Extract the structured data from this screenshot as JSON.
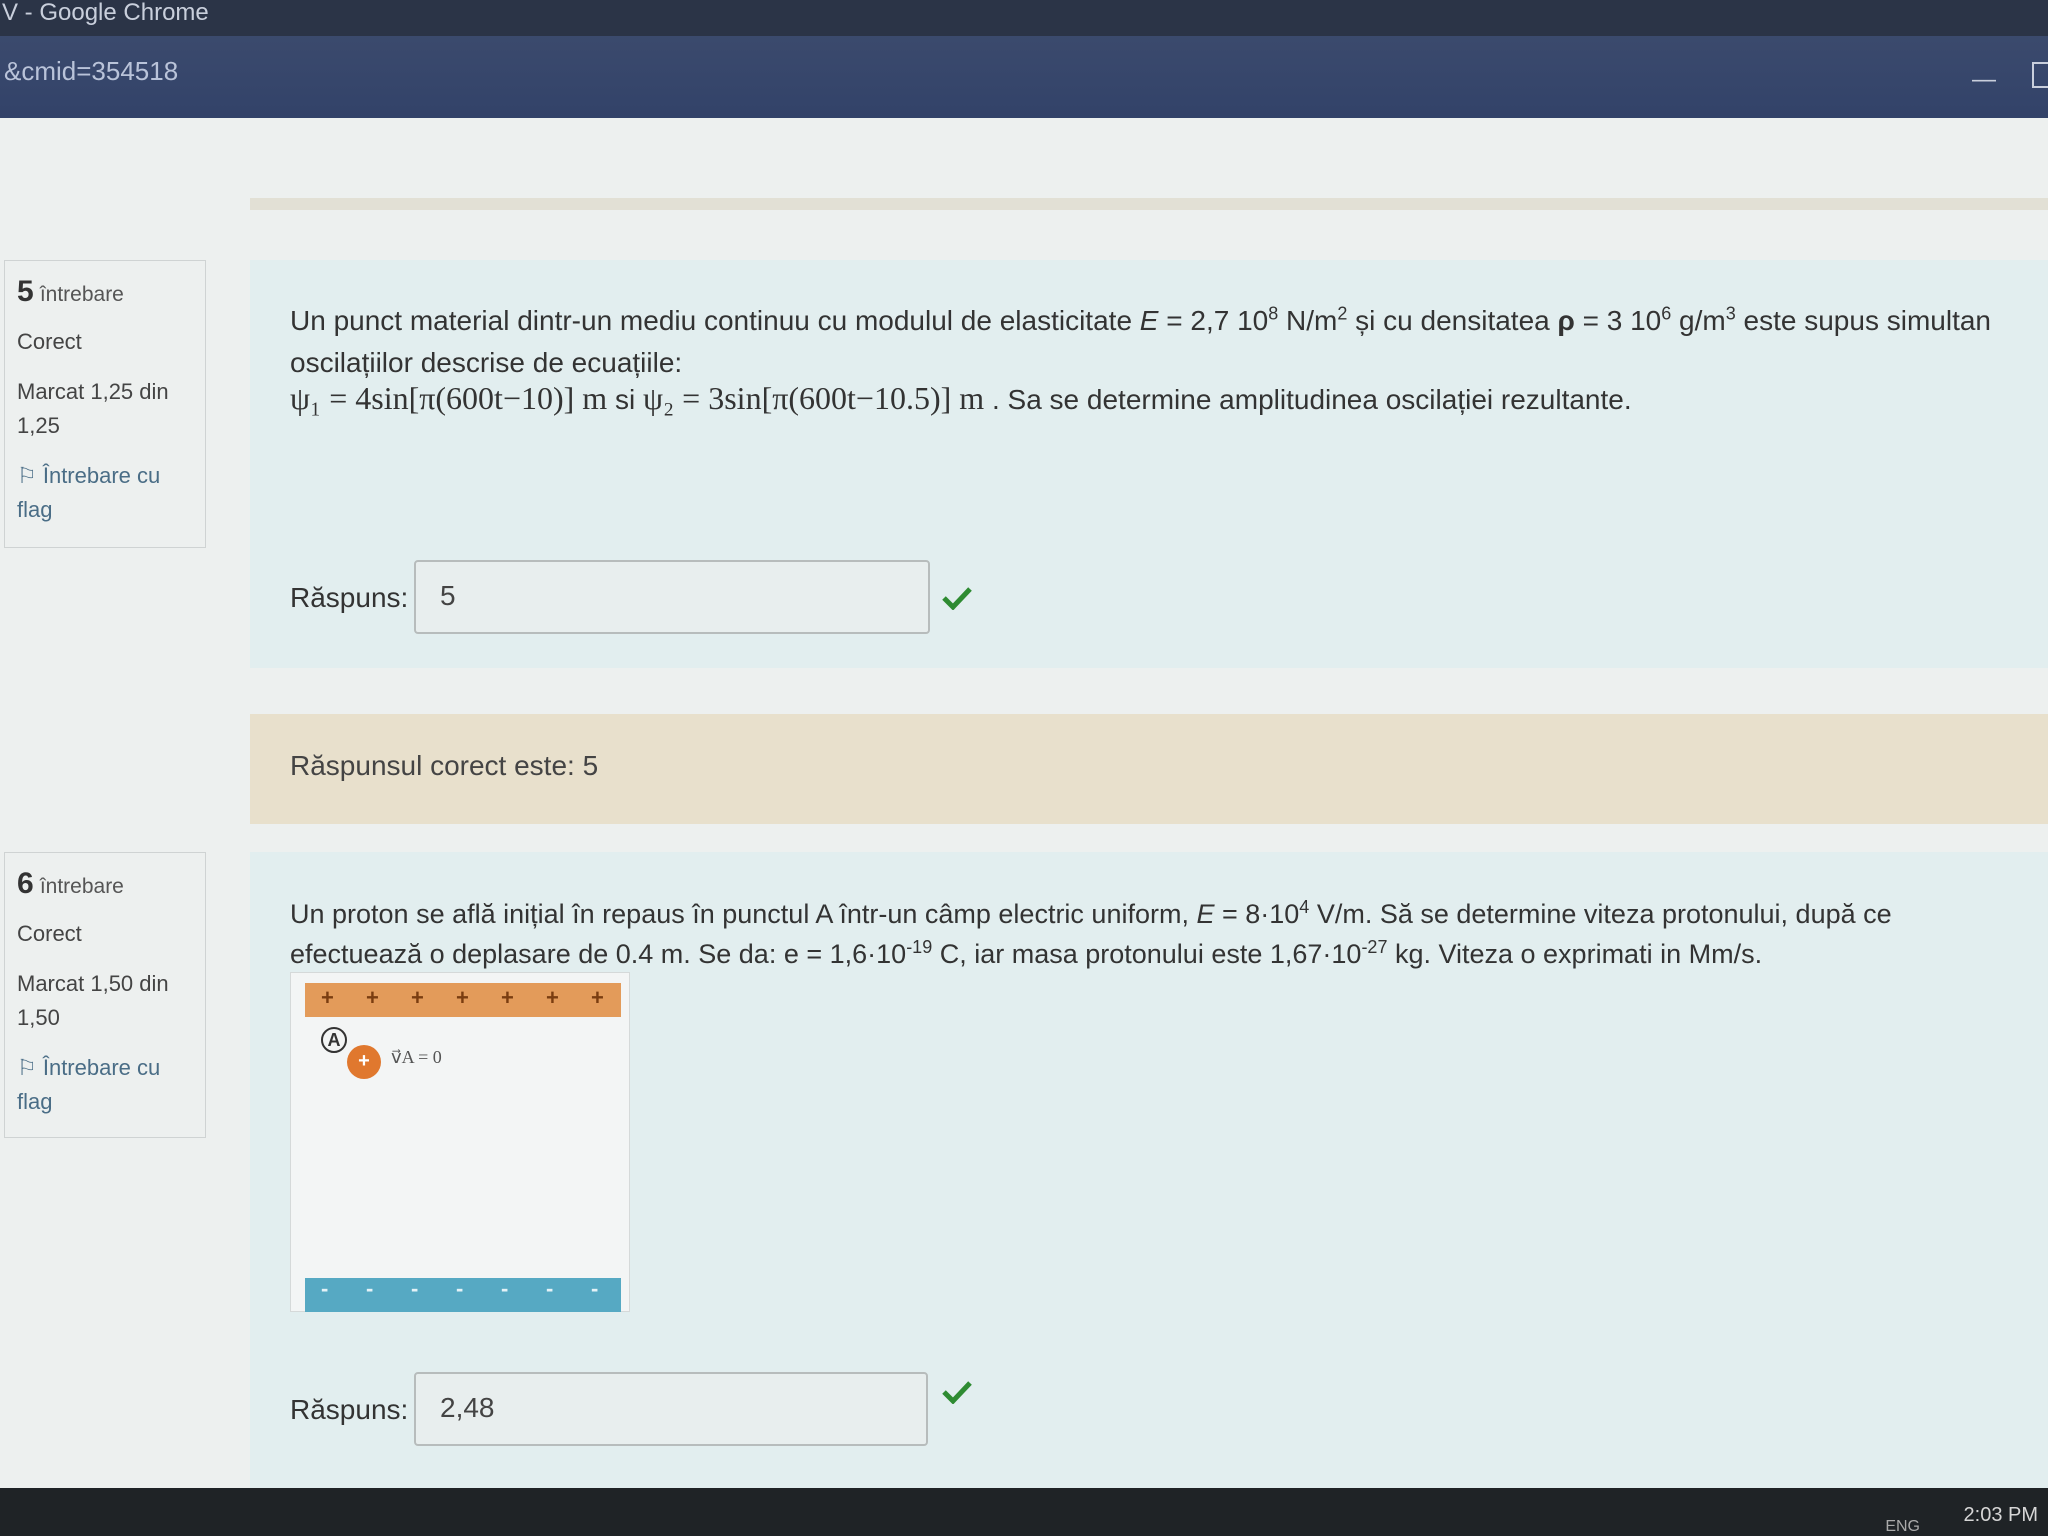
{
  "window": {
    "title": "V - Google Chrome",
    "url": "&cmid=354518"
  },
  "questions": [
    {
      "number": "5",
      "word": "întrebare",
      "status": "Corect",
      "mark": "Marcat 1,25 din 1,25",
      "flag": "Întrebare cu flag",
      "text_parts": {
        "a": "Un punct material dintr-un mediu continuu cu modulul de elasticitate ",
        "E": "E",
        "b": " = 2,7 10",
        "exp1": "8",
        "c": " N/m",
        "exp2": "2",
        "d": " și cu densitatea ",
        "rho": "ρ",
        "e": " = 3 10",
        "exp3": "6",
        "f": " g/m",
        "exp4": "3",
        "g": " este supus simultan oscilațiilor descrise de ecuațiile:"
      },
      "eq1": "ψ₁ = 4sin[π(600t−10)] m",
      "si": "si",
      "eq2": "ψ₂ = 3sin[π(600t−10.5)] m",
      "eq_tail": ". Sa se determine amplitudinea oscilației rezultante.",
      "answer_label": "Răspuns:",
      "answer_value": "5",
      "feedback": "Răspunsul corect este: 5"
    },
    {
      "number": "6",
      "word": "întrebare",
      "status": "Corect",
      "mark": "Marcat 1,50 din 1,50",
      "flag": "Întrebare cu flag",
      "text_parts": {
        "a": "Un proton se află inițial în repaus în punctul A într-un câmp electric uniform, ",
        "E": "E",
        "b": " = 8·10",
        "exp1": "4",
        "c": " V/m. Să se determine viteza protonului, după ce efectuează o deplasare de 0.4 m. Se da: e = 1,6·10",
        "exp2": "-19",
        "d": " C, iar masa protonului este 1,67·10",
        "exp3": "-27",
        "e": " kg.  Viteza o exprimati in Mm/s."
      },
      "figure": {
        "plus": "+",
        "minus": "-",
        "point": "A",
        "velocity": "v⃗A = 0"
      },
      "answer_label": "Răspuns:",
      "answer_value": "2,48"
    }
  ],
  "taskbar": {
    "time": "2:03 PM",
    "lang": "ENG"
  },
  "colors": {
    "check": "#2e8b32",
    "feedback_bg": "#e8e0cc",
    "question_bg": "#e2eeef"
  }
}
